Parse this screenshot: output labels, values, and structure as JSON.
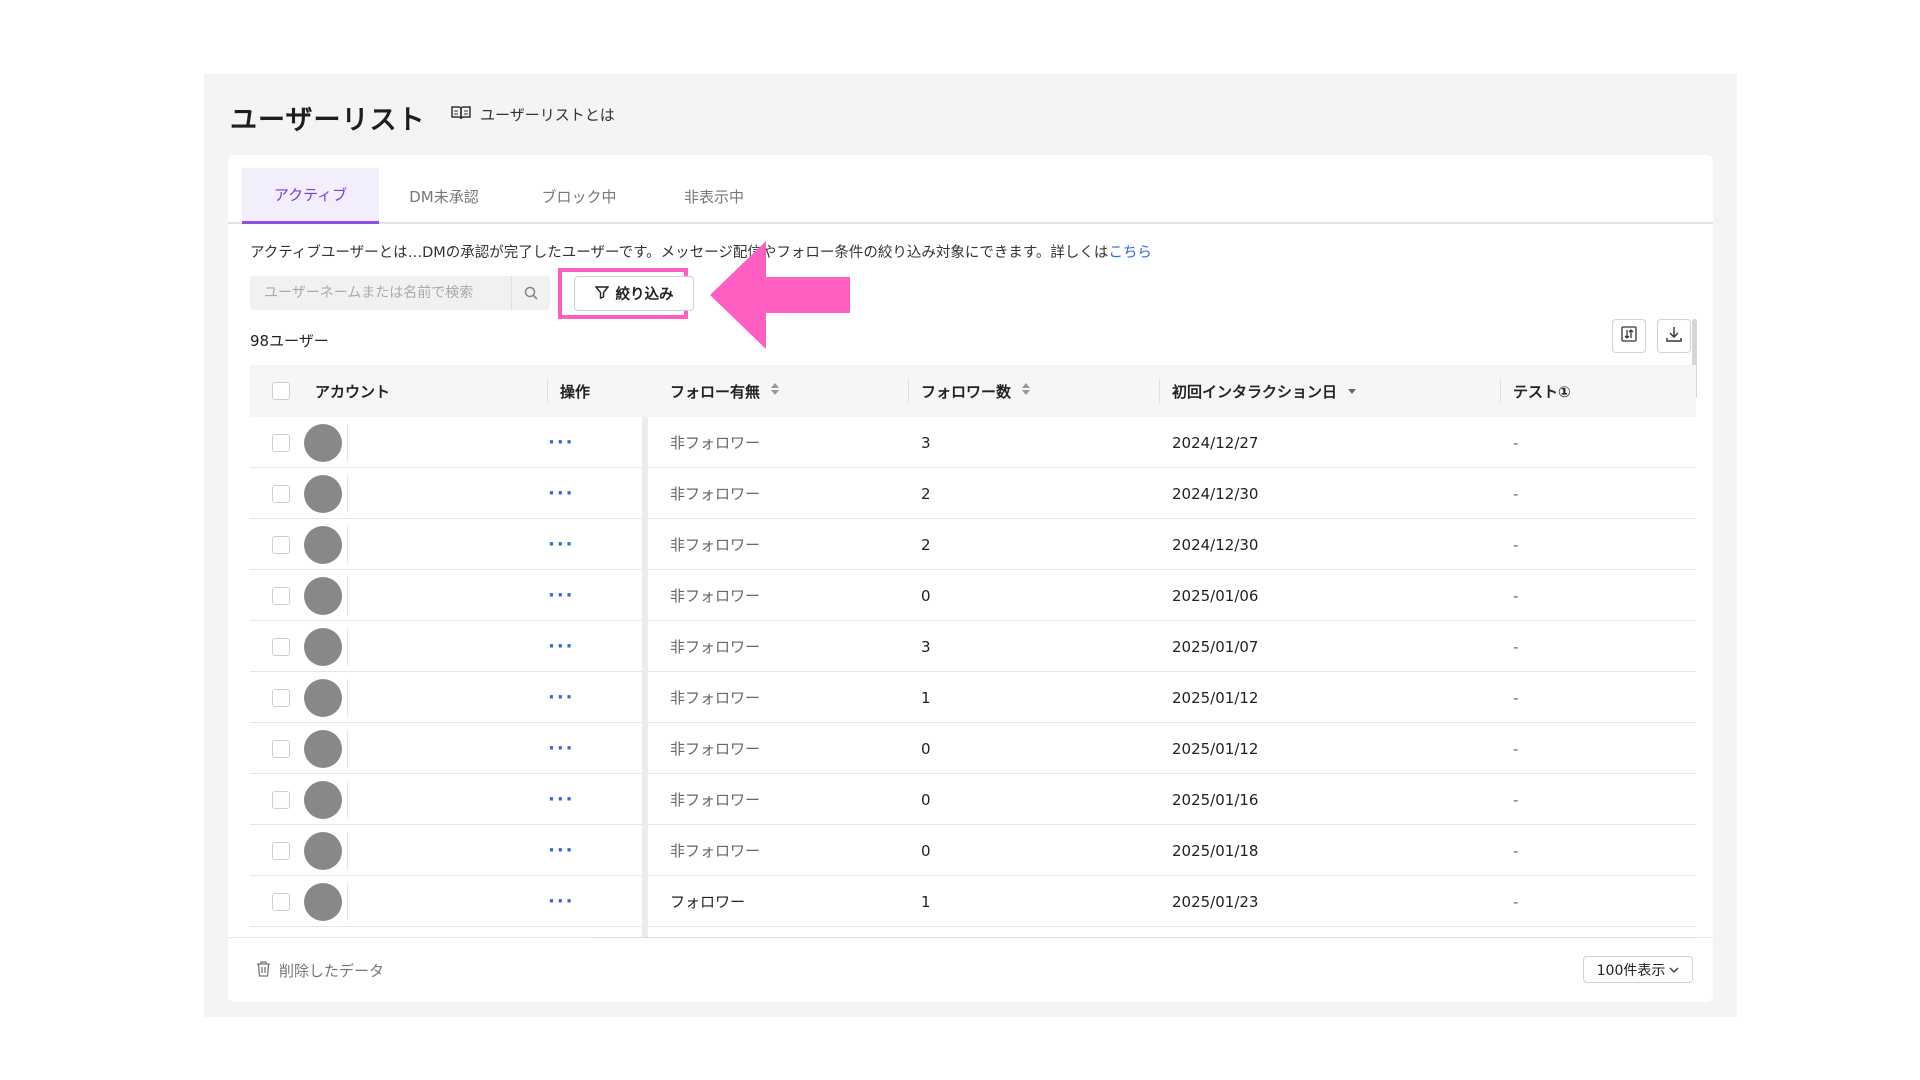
{
  "page": {
    "title": "ユーザーリスト",
    "help_link": "ユーザーリストとは"
  },
  "tabs": [
    {
      "label": "アクティブ",
      "active": true
    },
    {
      "label": "DM未承認",
      "active": false
    },
    {
      "label": "ブロック中",
      "active": false
    },
    {
      "label": "非表示中",
      "active": false
    }
  ],
  "description": {
    "text": "アクティブユーザーとは…DMの承認が完了したユーザーです。メッセージ配信やフォロー条件の絞り込み対象にできます。詳しくは",
    "link": "こちら"
  },
  "search": {
    "placeholder": "ユーザーネームまたは名前で検索"
  },
  "filter": {
    "label": "絞り込み",
    "highlight_color": "#ff5fc0"
  },
  "user_count": "98ユーザー",
  "table": {
    "headers": {
      "account": "アカウント",
      "operation": "操作",
      "follow_status": "フォロー有無",
      "followers": "フォロワー数",
      "first_interaction": "初回インタラクション日",
      "test": "テスト①"
    },
    "rows": [
      {
        "op": "···",
        "follow": "非フォロワー",
        "followers": "3",
        "date": "2024/12/27",
        "test": "-"
      },
      {
        "op": "···",
        "follow": "非フォロワー",
        "followers": "2",
        "date": "2024/12/30",
        "test": "-"
      },
      {
        "op": "···",
        "follow": "非フォロワー",
        "followers": "2",
        "date": "2024/12/30",
        "test": "-"
      },
      {
        "op": "···",
        "follow": "非フォロワー",
        "followers": "0",
        "date": "2025/01/06",
        "test": "-"
      },
      {
        "op": "···",
        "follow": "非フォロワー",
        "followers": "3",
        "date": "2025/01/07",
        "test": "-"
      },
      {
        "op": "···",
        "follow": "非フォロワー",
        "followers": "1",
        "date": "2025/01/12",
        "test": "-"
      },
      {
        "op": "···",
        "follow": "非フォロワー",
        "followers": "0",
        "date": "2025/01/12",
        "test": "-"
      },
      {
        "op": "···",
        "follow": "非フォロワー",
        "followers": "0",
        "date": "2025/01/16",
        "test": "-"
      },
      {
        "op": "···",
        "follow": "非フォロワー",
        "followers": "0",
        "date": "2025/01/18",
        "test": "-"
      },
      {
        "op": "···",
        "follow": "フォロワー",
        "followers": "1",
        "date": "2025/01/23",
        "test": "-"
      }
    ]
  },
  "footer": {
    "deleted_data": "削除したデータ",
    "per_page": "100件表示"
  },
  "colors": {
    "accent": "#8a4fe6",
    "link": "#2d6be0",
    "arrow": "#ff5fc0"
  }
}
